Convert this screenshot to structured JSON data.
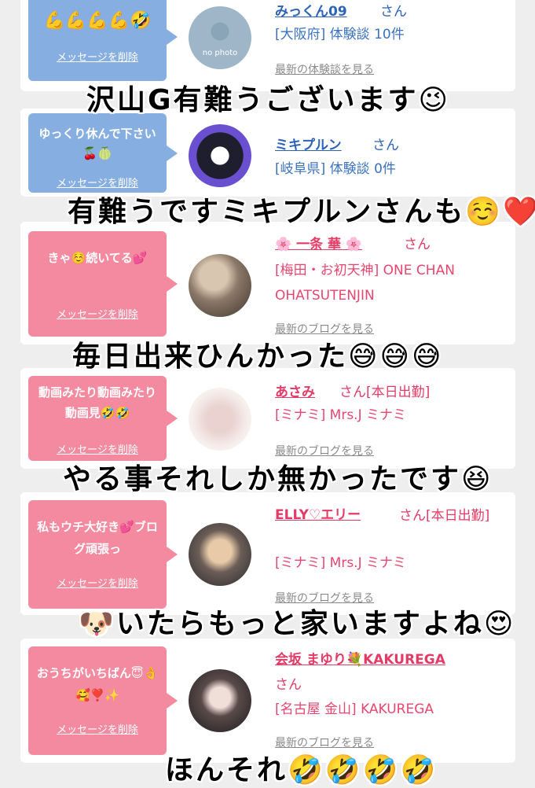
{
  "cards": [
    {
      "color": "blue",
      "bubble_text": "💪💪💪💪🤣",
      "delete_label": "メッセージを削除",
      "name": "みっくん09",
      "honorific": "さん",
      "meta": "[大阪府] 体験談 10件",
      "latest_link": "最新の体験談を見る",
      "avatar_text": "no photo"
    },
    {
      "color": "blue",
      "bubble_text": "ゆっくり休んで下さい🍒🍈",
      "delete_label": "メッセージを削除",
      "name": "ミキプルン",
      "honorific": "さん",
      "meta": "[岐阜県] 体験談 0件",
      "latest_link": ""
    },
    {
      "color": "pink",
      "bubble_text": "きゃ☺️続いてる💕",
      "delete_label": "メッセージを削除",
      "name": "🌸 一条 華 🌸",
      "honorific": "さん",
      "meta": "[梅田・お初天神] ONE CHAN OHATSUTENJIN",
      "latest_link": "最新のブログを見る"
    },
    {
      "color": "pink",
      "bubble_text": "動画みたり動画みたり動画見🤣🤣",
      "delete_label": "メッセージを削除",
      "name": "あさみ",
      "honorific": "さん[本日出勤]",
      "meta": "[ミナミ] Mrs.J ミナミ",
      "latest_link": "最新のブログを見る"
    },
    {
      "color": "pink",
      "bubble_text": "私もウチ大好き💕ブログ頑張っ",
      "delete_label": "メッセージを削除",
      "name": "ELLY♡エリー",
      "honorific": "さん[本日出勤]",
      "meta": "[ミナミ] Mrs.J ミナミ",
      "latest_link": "最新のブログを見る"
    },
    {
      "color": "pink",
      "bubble_text": "おうちがいちばん😇👌🥰❣️✨",
      "delete_label": "メッセージを削除",
      "name": "会坂 まゆり💐KAKUREGA",
      "honorific": "さん",
      "meta": "[名古屋 金山] KAKUREGA",
      "latest_link": "最新のブログを見る"
    }
  ],
  "captions": [
    "沢山G有難うございます😉",
    "有難うですミキプルンさんも☺️❤️",
    "毎日出来ひんかった😅😅😅",
    "やる事それしか無かったです😆",
    "🐶いたらもっと家いますよね😍",
    "ほんそれ🤣🤣🤣🤣"
  ],
  "colors": {
    "blue_bubble": "#86aee0",
    "pink_bubble": "#f48aa0",
    "blue_link": "#2c63b8",
    "pink_link": "#e23b66",
    "background": "#eeeeee"
  }
}
